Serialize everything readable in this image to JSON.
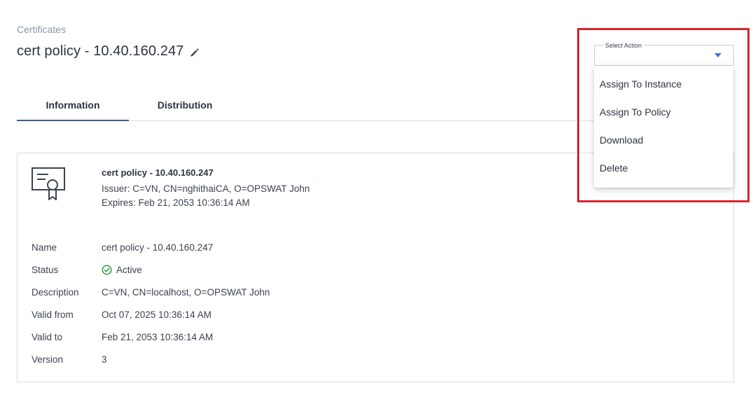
{
  "breadcrumb": "Certificates",
  "page": {
    "title": "cert policy - 10.40.160.247"
  },
  "tabs": [
    {
      "label": "Information",
      "active": true
    },
    {
      "label": "Distribution",
      "active": false
    }
  ],
  "certificate": {
    "summary_title": "cert policy - 10.40.160.247",
    "issuer": "Issuer: C=VN, CN=nghithaiCA, O=OPSWAT John",
    "expires": "Expires: Feb 21, 2053 10:36:14 AM"
  },
  "details": [
    {
      "label": "Name",
      "value": "cert policy - 10.40.160.247"
    },
    {
      "label": "Status",
      "value": "Active"
    },
    {
      "label": "Description",
      "value": "C=VN, CN=localhost, O=OPSWAT John"
    },
    {
      "label": "Valid from",
      "value": "Oct 07, 2025 10:36:14 AM"
    },
    {
      "label": "Valid to",
      "value": "Feb 21, 2053 10:36:14 AM"
    },
    {
      "label": "Version",
      "value": "3"
    }
  ],
  "select_action": {
    "label": "Select Action",
    "options": [
      "Assign To Instance",
      "Assign To Policy",
      "Download",
      "Delete"
    ]
  },
  "icons": {
    "edit": "pencil-icon",
    "certificate": "certificate-icon",
    "status": "check-circle-icon",
    "dropdown": "chevron-down-icon"
  },
  "colors": {
    "accent": "#3f76d8",
    "active_tab_underline": "#3d5b85",
    "status_active": "#2e9a44",
    "highlight": "#d7262e"
  }
}
